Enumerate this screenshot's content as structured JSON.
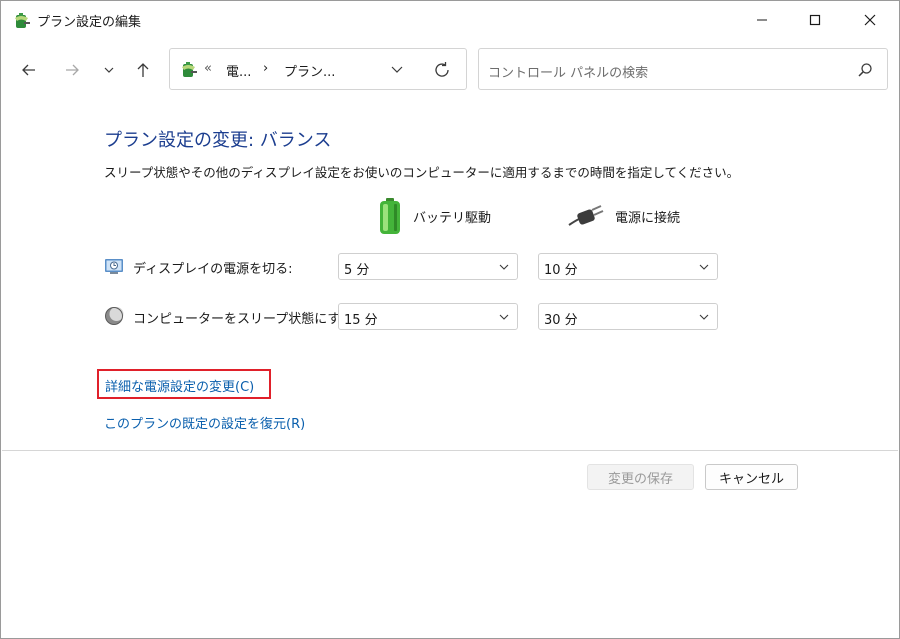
{
  "window": {
    "title": "プラン設定の編集"
  },
  "nav": {
    "breadcrumb_overflow": "«",
    "breadcrumb_1": "電...",
    "breadcrumb_sep": "›",
    "breadcrumb_2": "プラン..."
  },
  "search": {
    "placeholder": "コントロール パネルの検索"
  },
  "main": {
    "heading": "プラン設定の変更: バランス",
    "description": "スリープ状態やその他のディスプレイ設定をお使いのコンピューターに適用するまでの時間を指定してください。",
    "columns": {
      "battery": "バッテリ駆動",
      "plugged_in": "電源に接続"
    },
    "rows": [
      {
        "label": "ディスプレイの電源を切る:",
        "battery_value": "5 分",
        "plugged_value": "10 分"
      },
      {
        "label": "コンピューターをスリープ状態にする:",
        "battery_value": "15 分",
        "plugged_value": "30 分"
      }
    ],
    "links": {
      "advanced": "詳細な電源設定の変更(C)",
      "restore": "このプランの既定の設定を復元(R)"
    }
  },
  "footer": {
    "save_label": "変更の保存",
    "cancel_label": "キャンセル"
  },
  "colors": {
    "heading": "#1b3d8f",
    "link": "#0a5fad",
    "highlight": "#e0202a"
  }
}
